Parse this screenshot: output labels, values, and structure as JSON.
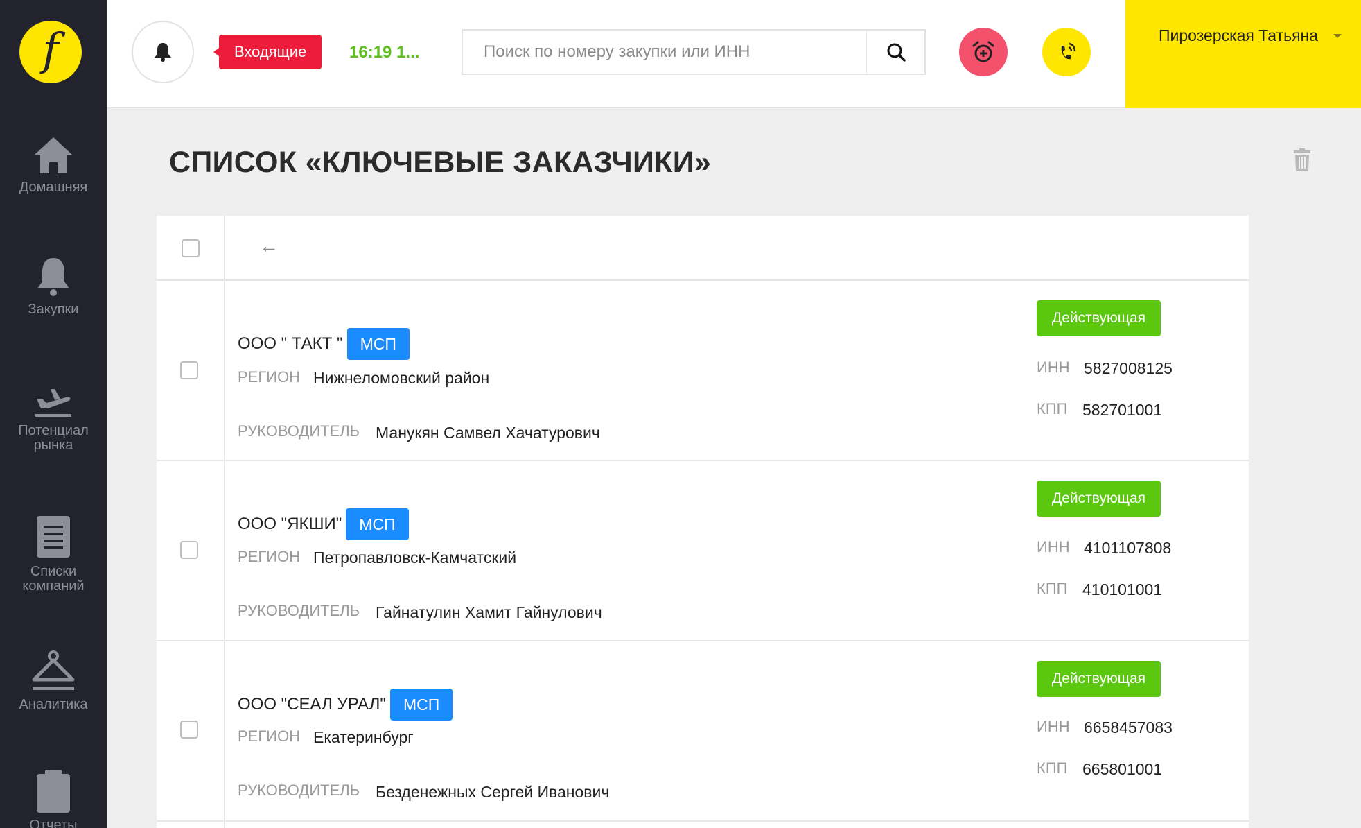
{
  "sidebar": {
    "logo": "f",
    "items": [
      {
        "label": "Домашняя",
        "icon": "home-icon"
      },
      {
        "label": "Закупки",
        "icon": "bell-icon"
      },
      {
        "label": "Потенциал рынка",
        "icon": "plane-icon"
      },
      {
        "label": "Списки компаний",
        "icon": "document-icon"
      },
      {
        "label": "Аналитика",
        "icon": "hanger-icon"
      },
      {
        "label": "Отчеты",
        "icon": "clipboard-icon"
      }
    ]
  },
  "header": {
    "incoming_label": "Входящие",
    "clock": "16:19 1...",
    "search_placeholder": "Поиск по номеру закупки или ИНН",
    "user_name": "Пирозерская Татьяна",
    "colors": {
      "accent": "#ffe600",
      "danger": "#ee1c3b",
      "success": "#5cc70f",
      "badge": "#1a8cff"
    }
  },
  "page": {
    "title": "СПИСОК «КЛЮЧЕВЫЕ ЗАКАЗЧИКИ»",
    "back_symbol": "←"
  },
  "labels": {
    "region": "РЕГИОН",
    "director": "РУКОВОДИТЕЛЬ",
    "inn": "ИНН",
    "kpp": "КПП",
    "msp": "МСП",
    "status": "Действующая"
  },
  "companies": [
    {
      "name": "ООО \" ТАКТ \"",
      "region": "Нижнеломовский район",
      "director": "Манукян Самвел Хачатурович",
      "inn": "5827008125",
      "kpp": "582701001",
      "status": "Действующая",
      "badge": "МСП"
    },
    {
      "name": "ООО \"ЯКШИ\"",
      "region": "Петропавловск-Камчатский",
      "director": "Гайнатулин Хамит Гайнулович",
      "inn": "4101107808",
      "kpp": "410101001",
      "status": "Действующая",
      "badge": "МСП"
    },
    {
      "name": "ООО \"СЕАЛ УРАЛ\"",
      "region": "Екатеринбург",
      "director": "Безденежных Сергей Иванович",
      "inn": "6658457083",
      "kpp": "665801001",
      "status": "Действующая",
      "badge": "МСП"
    }
  ]
}
